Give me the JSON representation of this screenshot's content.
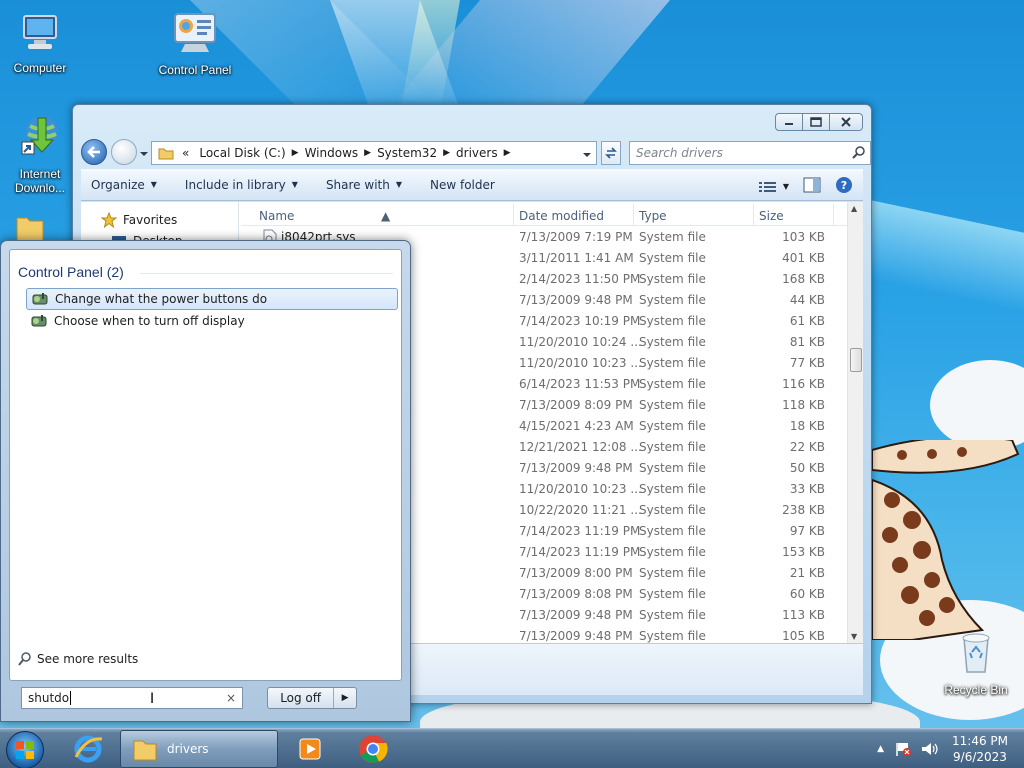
{
  "desktop": {
    "icons": [
      {
        "label": "Computer"
      },
      {
        "label": "Control Panel"
      },
      {
        "label": "Internet Downlo..."
      },
      {
        "label": "Recycle Bin"
      }
    ]
  },
  "explorer": {
    "address": {
      "overflow": "«",
      "crumbs": [
        "Local Disk (C:)",
        "Windows",
        "System32",
        "drivers"
      ]
    },
    "search_placeholder": "Search drivers",
    "toolbar": {
      "organize": "Organize",
      "include_in_library": "Include in library",
      "share_with": "Share with",
      "new_folder": "New folder"
    },
    "nav": {
      "favorites": "Favorites",
      "desktop": "Desktop"
    },
    "columns": {
      "name": "Name",
      "date": "Date modified",
      "type": "Type",
      "size": "Size"
    },
    "files": [
      {
        "name": "i8042prt.sys",
        "date": "7/13/2009 7:19 PM",
        "type": "System file",
        "size": "103 KB"
      },
      {
        "name": "",
        "date": "3/11/2011 1:41 AM",
        "type": "System file",
        "size": "401 KB"
      },
      {
        "name": "",
        "date": "2/14/2023 11:50 PM",
        "type": "System file",
        "size": "168 KB"
      },
      {
        "name": "",
        "date": "7/13/2009 9:48 PM",
        "type": "System file",
        "size": "44 KB"
      },
      {
        "name": "",
        "date": "7/14/2023 10:19 PM",
        "type": "System file",
        "size": "61 KB"
      },
      {
        "name": "",
        "date": "11/20/2010 10:24 ...",
        "type": "System file",
        "size": "81 KB"
      },
      {
        "name": "",
        "date": "11/20/2010 10:23 ...",
        "type": "System file",
        "size": "77 KB"
      },
      {
        "name": "",
        "date": "6/14/2023 11:53 PM",
        "type": "System file",
        "size": "116 KB"
      },
      {
        "name": "",
        "date": "7/13/2009 8:09 PM",
        "type": "System file",
        "size": "118 KB"
      },
      {
        "name": "",
        "date": "4/15/2021 4:23 AM",
        "type": "System file",
        "size": "18 KB"
      },
      {
        "name": "",
        "date": "12/21/2021 12:08 ...",
        "type": "System file",
        "size": "22 KB"
      },
      {
        "name": "",
        "date": "7/13/2009 9:48 PM",
        "type": "System file",
        "size": "50 KB"
      },
      {
        "name": "",
        "date": "11/20/2010 10:23 ...",
        "type": "System file",
        "size": "33 KB"
      },
      {
        "name": "",
        "date": "10/22/2020 11:21 ...",
        "type": "System file",
        "size": "238 KB"
      },
      {
        "name": "",
        "date": "7/14/2023 11:19 PM",
        "type": "System file",
        "size": "97 KB"
      },
      {
        "name": "",
        "date": "7/14/2023 11:19 PM",
        "type": "System file",
        "size": "153 KB"
      },
      {
        "name": "",
        "date": "7/13/2009 8:00 PM",
        "type": "System file",
        "size": "21 KB"
      },
      {
        "name": "",
        "date": "7/13/2009 8:08 PM",
        "type": "System file",
        "size": "60 KB"
      },
      {
        "name": "",
        "date": "7/13/2009 9:48 PM",
        "type": "System file",
        "size": "113 KB"
      },
      {
        "name": "",
        "date": "7/13/2009 9:48 PM",
        "type": "System file",
        "size": "105 KB"
      }
    ]
  },
  "startmenu": {
    "group_label": "Control Panel (2)",
    "results": [
      {
        "label": "Change what the power buttons do",
        "selected": true
      },
      {
        "label": "Choose when to turn off display",
        "selected": false
      }
    ],
    "see_more": "See more results",
    "search_value": "shutdo",
    "clear_glyph": "×",
    "logoff_label": "Log off",
    "logoff_arrow": "▶"
  },
  "taskbar": {
    "active_window": "drivers",
    "clock_time": "11:46 PM",
    "clock_date": "9/6/2023"
  },
  "colors": {
    "accent": "#1e3b6e",
    "desktop": "#2aa2e6",
    "taskbar": "#3e5f80"
  }
}
